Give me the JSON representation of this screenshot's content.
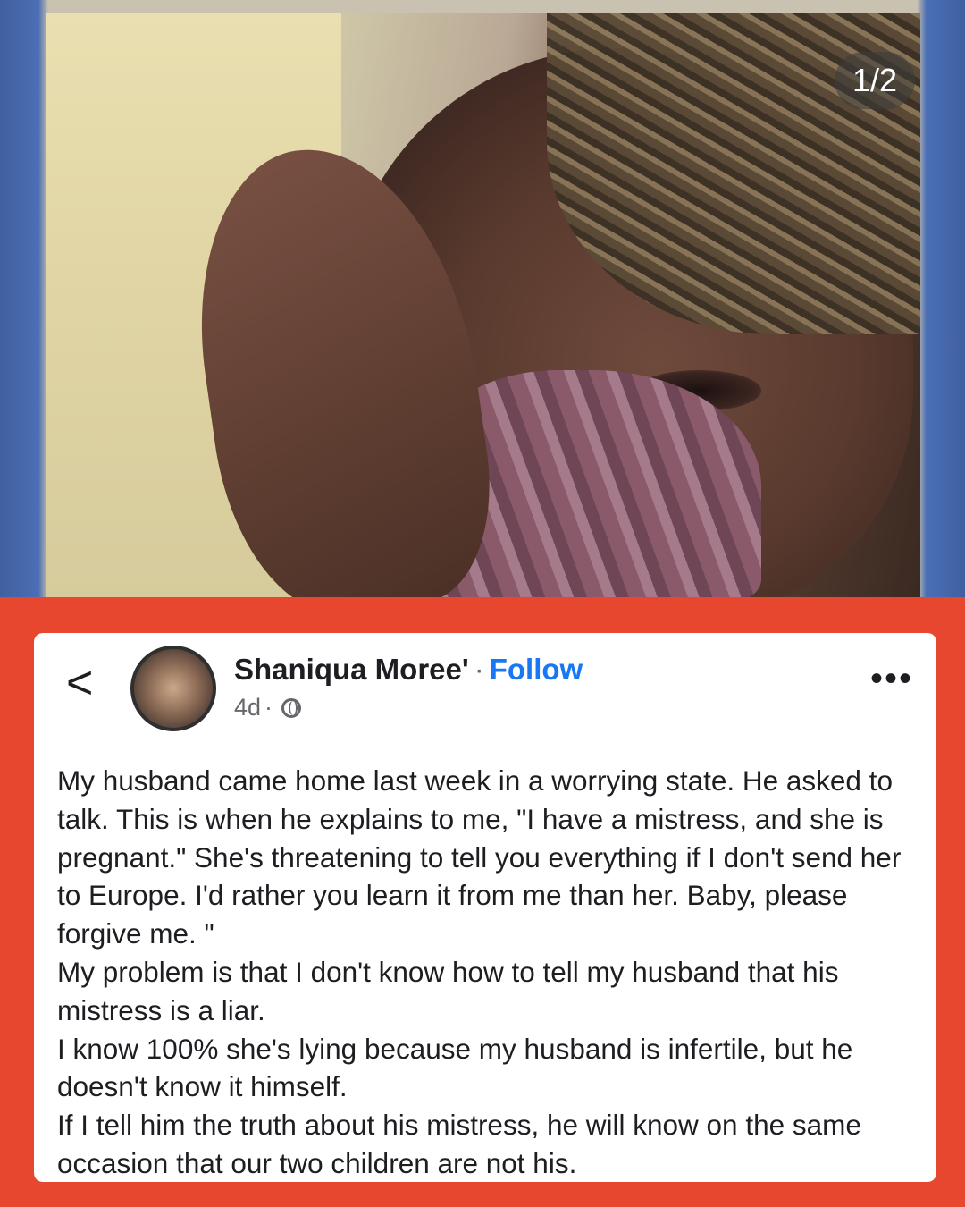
{
  "photo": {
    "counter": "1/2"
  },
  "post": {
    "author_name": "Shaniqua Moree'",
    "separator": "·",
    "follow_label": "Follow",
    "timestamp": "4d",
    "meta_separator": "·",
    "privacy_icon": "globe-icon",
    "back_icon": "chevron-left-icon",
    "back_glyph": "<",
    "more_icon": "more-horizontal-icon",
    "more_glyph": "•••",
    "paragraphs": [
      "My husband came home last week in a worrying state. He asked to talk. This is when he explains to me, \"I have a mistress, and she is pregnant.\" She's threatening to tell you everything if I don't send her to Europe. I'd rather you learn it from me than her. Baby, please forgive me. \"",
      "My problem is that I don't know how to tell my husband that his mistress is a liar.",
      "I know 100% she's lying because my husband is infertile, but he doesn't know it himself.",
      "If I tell him the truth about his mistress, he will know on the same occasion that our two children are not his."
    ]
  },
  "colors": {
    "background": "#e8472f",
    "follow": "#1877f2",
    "text": "#1c1e21",
    "secondary_text": "#65676b"
  }
}
